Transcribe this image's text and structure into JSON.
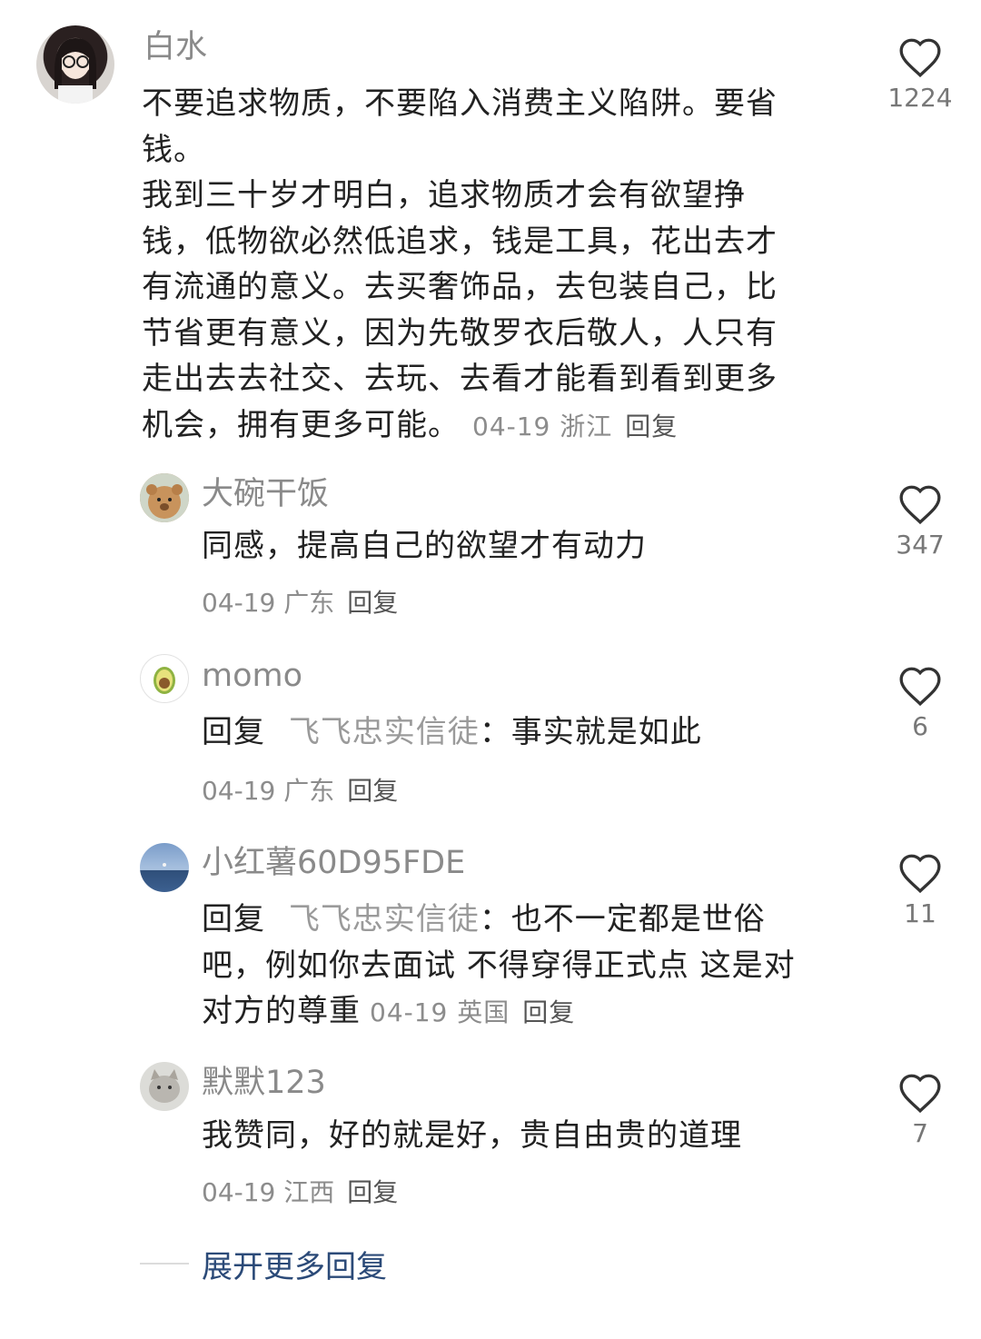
{
  "main_comment": {
    "author": "白水",
    "text_lines": [
      "不要追求物质，不要陷入消费主义陷阱。要省",
      "钱。",
      "我到三十岁才明白，追求物质才会有欲望挣",
      "钱，低物欲必然低追求，钱是工具，花出去才",
      "有流通的意义。去买奢饰品，去包装自己，比",
      "节省更有意义，因为先敬罗衣后敬人，人只有",
      "走出去去社交、去玩、去看才能看到看到更多",
      "机会，拥有更多可能。"
    ],
    "date": "04-19",
    "location": "浙江",
    "reply_label": "回复",
    "likes": "1224"
  },
  "replies": [
    {
      "author": "大碗干饭",
      "text": "同感，提高自己的欲望才有动力",
      "date": "04-19",
      "location": "广东",
      "reply_label": "回复",
      "likes": "347"
    },
    {
      "author": "momo",
      "prefix": "回复",
      "quoted": "飞飞忠实信徒",
      "text": "：事实就是如此",
      "date": "04-19",
      "location": "广东",
      "reply_label": "回复",
      "likes": "6"
    },
    {
      "author": "小红薯60D95FDE",
      "prefix": "回复",
      "quoted": "飞飞忠实信徒",
      "text_line1": "：也不一定都是世俗",
      "text_line2": "吧，例如你去面试 不得穿得正式点 这是对",
      "text_line3": "对方的尊重",
      "date": "04-19",
      "location": "英国",
      "reply_label": "回复",
      "likes": "11"
    },
    {
      "author": "默默123",
      "text": "我赞同，好的就是好，贵自由贵的道理",
      "date": "04-19",
      "location": "江西",
      "reply_label": "回复",
      "likes": "7"
    }
  ],
  "expand_more": "展开更多回复",
  "icons": {
    "like": "heart-outline-icon"
  },
  "colors": {
    "link_blue": "#2b4a78",
    "meta_gray": "#8c8c8c"
  }
}
